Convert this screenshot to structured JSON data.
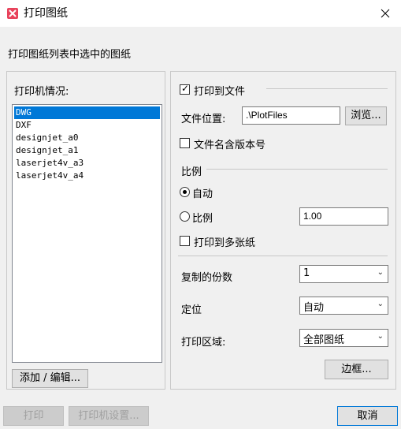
{
  "window": {
    "title": "打印图纸"
  },
  "subtitle": "打印图纸列表中选中的图纸",
  "printers": {
    "label": "打印机情况:",
    "items": [
      "DWG",
      "DXF",
      "designjet_a0",
      "designjet_a1",
      "laserjet4v_a3",
      "laserjet4v_a4"
    ],
    "selected": "DWG",
    "add_edit_label": "添加 / 编辑..."
  },
  "print_to_file": {
    "label": "打印到文件",
    "checked": true,
    "location_label": "文件位置:",
    "location_value": ".\\PlotFiles",
    "browse_label": "浏览...",
    "include_version_label": "文件名含版本号",
    "include_version_checked": false
  },
  "scale": {
    "label": "比例",
    "auto_label": "自动",
    "auto_selected": true,
    "ratio_label": "比例",
    "ratio_value": "1.00",
    "multi_sheet_label": "打印到多张纸",
    "multi_sheet_checked": false
  },
  "copies": {
    "label": "复制的份数",
    "value": "1"
  },
  "orientation": {
    "label": "定位",
    "value": "自动"
  },
  "print_area": {
    "label": "打印区域:",
    "value": "全部图纸"
  },
  "border_label": "边框...",
  "footer": {
    "print_label": "打印",
    "printer_settings_label": "打印机设置...",
    "cancel_label": "取消"
  }
}
